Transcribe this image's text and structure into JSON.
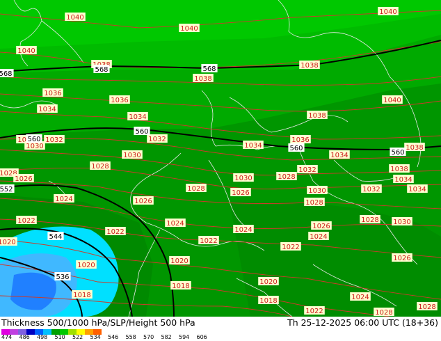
{
  "footer": {
    "title": "Thickness 500/1000 hPa/SLP/Height 500 hPa",
    "datetime": "Th 25-12-2025 06:00 UTC (18+36)"
  },
  "color_scale": {
    "ticks": [
      "474",
      "486",
      "498",
      "510",
      "522",
      "534",
      "546",
      "558",
      "570",
      "582",
      "594",
      "606"
    ],
    "colors": [
      "#e000e0",
      "#c040e0",
      "#8060e0",
      "#0000c0",
      "#0060ff",
      "#00c0ff",
      "#00a000",
      "#00c800",
      "#a0e000",
      "#ffff00",
      "#ffa000",
      "#ff6000"
    ]
  },
  "map": {
    "isobar_labels": [
      "1040",
      "1040",
      "1040",
      "1038",
      "1038",
      "1038",
      "1040",
      "1040",
      "1036",
      "1036",
      "1034",
      "1034",
      "1038",
      "1040",
      "1032",
      "1030",
      "1032",
      "1034",
      "1036",
      "1034",
      "1038",
      "1030",
      "1028",
      "1030",
      "1032",
      "1038",
      "1028",
      "1026",
      "1028",
      "1026",
      "1028",
      "1034",
      "1024",
      "1026",
      "1030",
      "1032",
      "1034",
      "1028",
      "1022",
      "1022",
      "1024",
      "1024",
      "1026",
      "1028",
      "1030",
      "1020",
      "1022",
      "1022",
      "1024",
      "1020",
      "1020",
      "1026",
      "1018",
      "1018",
      "1018",
      "1020",
      "1022",
      "1024",
      "1028",
      "1028"
    ],
    "height_labels": [
      "568",
      "568",
      "568",
      "560",
      "560",
      "560",
      "560",
      "552",
      "544",
      "536"
    ]
  }
}
